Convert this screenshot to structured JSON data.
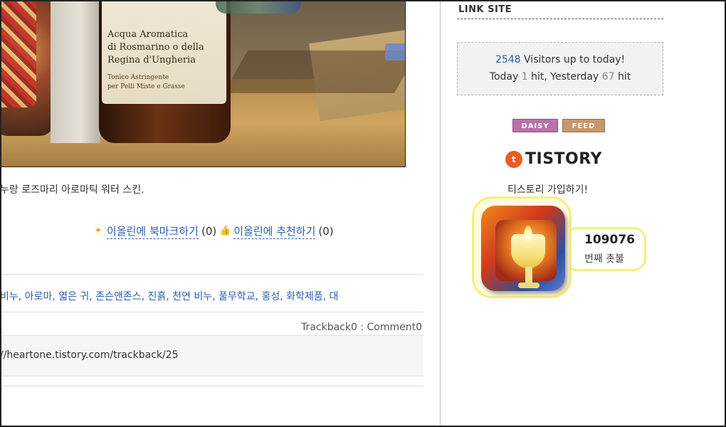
{
  "photo": {
    "label_line1": "Acqua Aromatica",
    "label_line2": "di Rosmarino o della",
    "label_line3": "Regina d'Ungheria",
    "label_line4": "Tonico Astringente",
    "label_line5": "per Pelli Miste e Grasse"
  },
  "post": {
    "caption": "누랑 로즈마리 아로마틱 워터 스킨.",
    "bookmark_label": "이올린에 북마크하기",
    "bookmark_count": "(0)",
    "recommend_label": "이올린에 추천하기",
    "recommend_count": "(0)",
    "tags": "비누, 아로마, 엷은 귀, 존슨앤존스, 진흙, 천연 비누, 풀무학교, 홍성, 화학제품, 대",
    "trackback_counts": "Trackback0 : Comment0",
    "trackback_url": "//heartone.tistory.com/trackback/25"
  },
  "sidebar": {
    "title": "LINK SITE",
    "visitors_total": "2548",
    "visitors_total_suffix": " Visitors up to today!",
    "today_prefix": "Today ",
    "today_count": "1",
    "yesterday_prefix": " hit, Yesterday ",
    "yesterday_count": "67",
    "yesterday_suffix": " hit",
    "badge_daisy": "DAISY",
    "badge_feed": "FEED",
    "tistory_word": "TISTORY",
    "tistory_join": "티스토리 가입하기!",
    "candle_number": "109076",
    "candle_sub": "번째 촛불"
  },
  "colors": {
    "link": "#2a5db0",
    "daisy": "#b873a8",
    "feed": "#c7976b",
    "tistory_orange": "#f05a22"
  }
}
